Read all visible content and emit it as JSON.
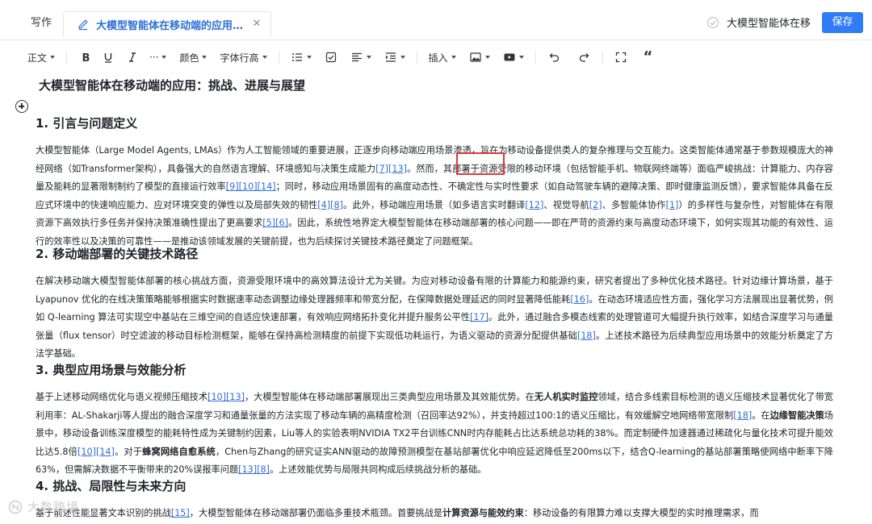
{
  "header": {
    "write_tab": "写作",
    "doc_tab_title": "大模型智能体在移动端的应用：...",
    "status_doc_name": "大模型智能体在移动",
    "save_label": "保存"
  },
  "toolbar": {
    "paragraph_style": "正文",
    "more": "···",
    "color": "颜色",
    "line_height": "字体行高",
    "insert": "插入",
    "quote_glyph": "“"
  },
  "document": {
    "title": "大模型智能体在移动端的应用：挑战、进展与展望",
    "sections": [
      {
        "heading": "1. 引言与问题定义"
      },
      {
        "heading": "2. 移动端部署的关键技术路径"
      },
      {
        "heading": "3. 典型应用场景与效能分析"
      },
      {
        "heading": "4. 挑战、局限性与未来方向"
      }
    ],
    "p1": [
      "大模型智能体（Large Model Agents, LMAs）作为人工智能领域的重要进展，正逐步向移动端应用场景渗透，旨在为移动设备提供类人的复杂推理与交互能力。这类智能体通常基于参数规模庞大的神经网络（如Transformer架构），具备强大的自然语言理解、环境感知与决策生成能力",
      "[7]",
      "[13]",
      "。然而，其部署于资源受限的移动环境（包括智能手机、物联网终端等）面临严峻挑战：计算能力、内存容量及能耗的显著限制制约了模型的直接运行效率",
      "[9]",
      "[10]",
      "[14]",
      "；同时，移动应用场景固有的高度动态性、不确定性与实时性要求（如自动驾驶车辆的避障决策、即时健康监测反馈），要求智能体具备在反应式环境中的快速响应能力、应对环境突变的弹性以及局部失效的韧性",
      "[4]",
      "[8]",
      "。此外，移动端应用场景（如多语言实时翻译",
      "[12]",
      "、视觉导航",
      "[2]",
      "、多智能体协作",
      "[1]",
      "）的多样性与复杂性，对智能体在有限资源下高效执行多任务并保持决策准确性提出了更高要求",
      "[5]",
      "[6]",
      "。因此，系统性地界定大模型智能体在移动端部署的核心问题——即在严苛的资源约束与高度动态环境下，如何实现其功能的有效性、运行的效率性以及决策的可靠性——是推动该领域发展的关键前提，也为后续探讨关键技术路径奠定了问题框架。"
    ],
    "p2": [
      "在解决移动端大模型智能体部署的核心挑战方面，资源受限环境中的高效算法设计尤为关键。为应对移动设备有限的计算能力和能源约束，研究者提出了多种优化技术路径。针对边缘计算场景，基于 Lyapunov 优化的在线决策策略能够根据实时数据速率动态调整边缘处理器频率和带宽分配，在保障数据处理延迟的同时显著降低能耗",
      "[16]",
      "。在动态环境适应性方面，强化学习方法展现出显著优势，例如 Q-learning 算法可实现空中基站在三维空间的自适应快速部署，有效响应网络拓扑变化并提升服务公平性",
      "[17]",
      "。此外，通过融合多模态线索的处理管道可大幅提升执行效率，如结合深度学习与通量张量（flux tensor）时空滤波的移动目标检测框架，能够在保持高检测精度的前提下实现低功耗运行，为语义驱动的资源分配提供基础",
      "[18]",
      "。上述技术路径为后续典型应用场景中的效能分析奠定了方法学基础。"
    ],
    "p3": [
      "基于上述移动网络优化与语义视频压缩技术",
      "[10]",
      "[13]",
      "，大模型智能体在移动端部署展现出三类典型应用场景及其效能优势。在",
      "无人机实时监控",
      "领域，结合多线索目标检测的语义压缩技术显著优化了带宽利用率：AL-Shakarji等人提出的融合深度学习和通量张量的方法实现了移动车辆的高精度检测（召回率达92%），并支持超过100:1的语义压缩比，有效缓解空地网络带宽限制",
      "[18]",
      "。在",
      "边缘智能决策",
      "场景中，移动设备训练深度模型的能耗特性成为关键制约因素，Liu等人的实验表明NVIDIA TX2平台训练CNN时内存能耗占比达系统总功耗的38%。而定制硬件加速器通过稀疏化与量化技术可提升能效比达5.8倍",
      "[10]",
      "[14]",
      "。对于",
      "蜂窝网络自愈系统",
      "，Chen与Zhang的研究证实ANN驱动的故障预测模型在基站部署优化中响应延迟降低至200ms以下，结合Q-learning的基站部署策略使网络中断率下降63%，但需解决数据不平衡带来的20%误报率问题",
      "[13]",
      "[8]",
      "。上述效能优势与局限共同构成后续挑战分析的基础。"
    ],
    "p4": [
      "基于前述性能显著文本识别的挑战",
      "[15]",
      "，大模型智能体在移动端部署仍面临多重技术瓶颈。首要挑战是",
      "计算资源与能效约束",
      "：移动设备的有限算力难以支撑大模型的实时推理需求，而"
    ]
  },
  "watermark": "大数跨境"
}
